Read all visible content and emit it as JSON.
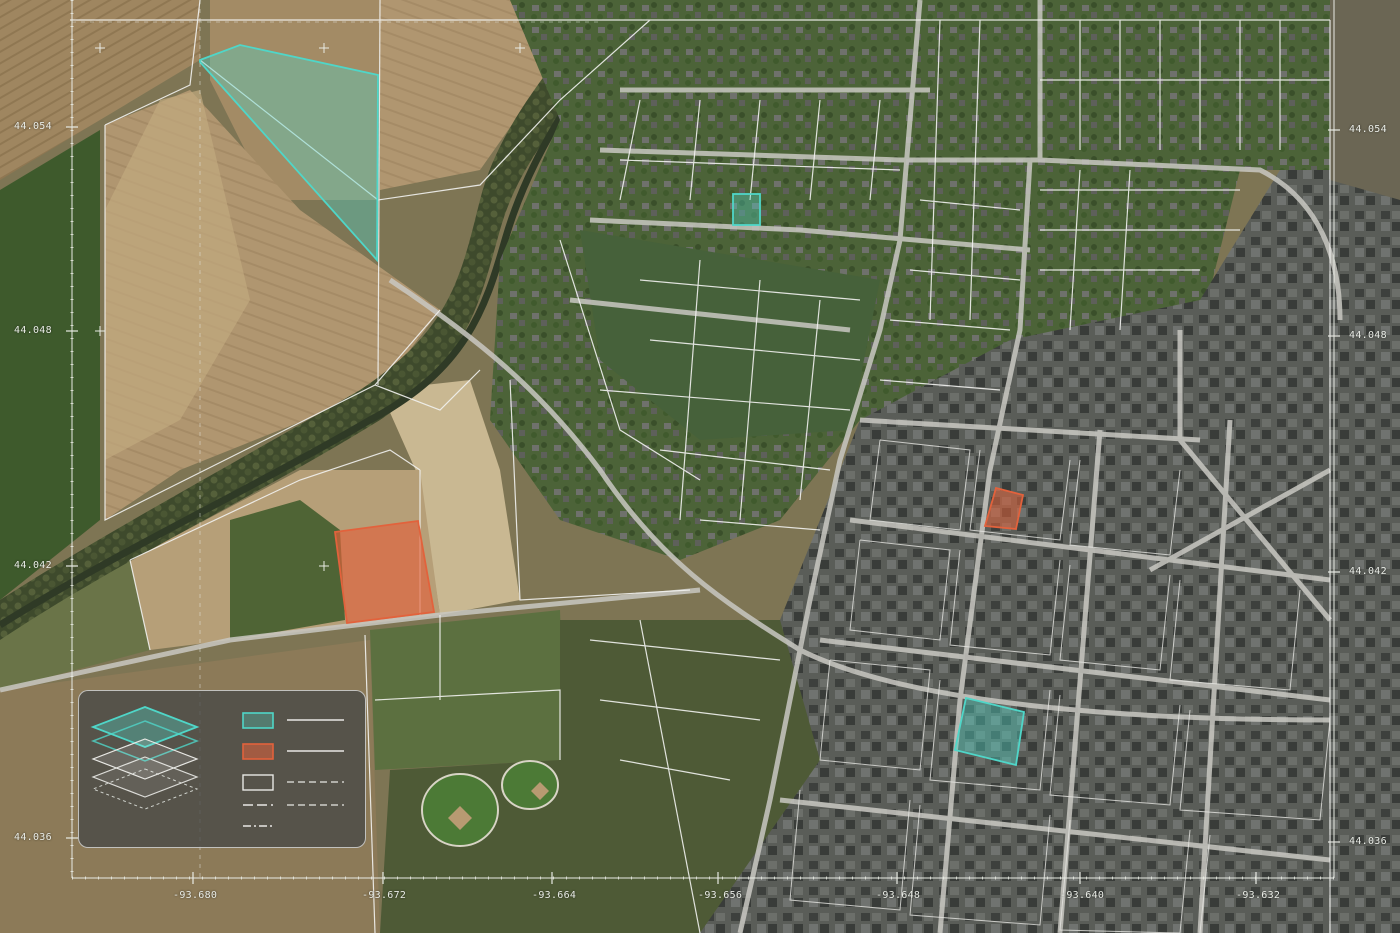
{
  "map": {
    "latitude_ticks": [
      "44.054",
      "44.048",
      "44.042",
      "44.036"
    ],
    "longitude_ticks": [
      "-93.680",
      "-93.672",
      "-93.664",
      "-93.656",
      "-93.648",
      "-93.640",
      "-93.632"
    ]
  },
  "highlighted_parcels": [
    {
      "name": "parcel-teal-farmland",
      "style": "teal"
    },
    {
      "name": "parcel-teal-residential",
      "style": "teal"
    },
    {
      "name": "parcel-teal-downtown",
      "style": "teal"
    },
    {
      "name": "parcel-orange-field",
      "style": "orange"
    },
    {
      "name": "parcel-orange-downtown",
      "style": "orange"
    }
  ],
  "legend": {
    "layer_icon": "stacked-layers-icon",
    "entries": [
      {
        "symbol": "teal-fill-swatch",
        "line": "solid-line"
      },
      {
        "symbol": "orange-fill-swatch",
        "line": "solid-line"
      },
      {
        "symbol": "outline-swatch",
        "line": "dashed-line"
      },
      {
        "symbol": "dash-line-symbol",
        "line": "dashed-line"
      },
      {
        "symbol": "dot-dash-line-symbol",
        "line": ""
      }
    ]
  },
  "colors": {
    "teal": "#4fd6c8",
    "orange": "#e2623c",
    "parcel_line": "#f2f2f0",
    "farmland": "#b39a72",
    "urban": "#6f716d",
    "residential": "#4f6a3c"
  }
}
